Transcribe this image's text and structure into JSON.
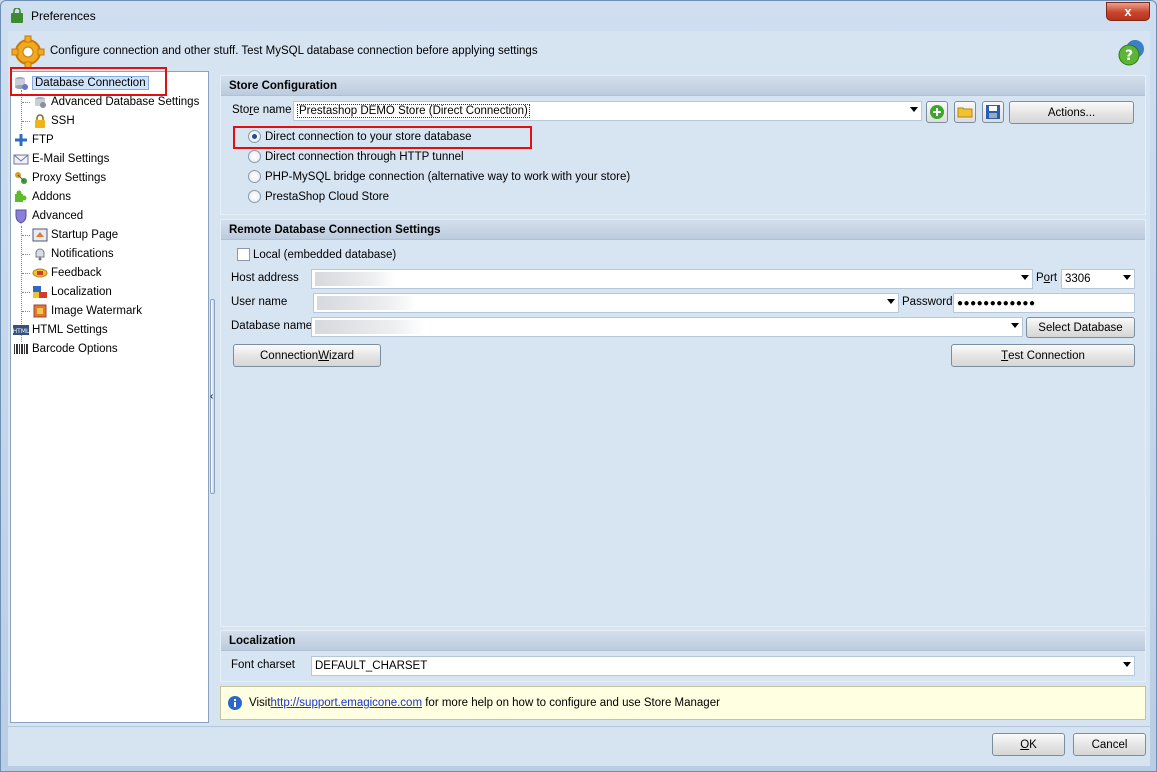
{
  "window": {
    "title": "Preferences",
    "close_symbol": "x",
    "header_text": "Configure connection and other stuff. Test MySQL database connection before applying settings"
  },
  "tree": {
    "items": [
      {
        "label": "Database Connection",
        "icon": "database-icon"
      },
      {
        "label": "Advanced Database Settings",
        "icon": "settings-icon"
      },
      {
        "label": "SSH",
        "icon": "lock-icon"
      },
      {
        "label": "FTP",
        "icon": "ftp-icon"
      },
      {
        "label": "E-Mail Settings",
        "icon": "mail-icon"
      },
      {
        "label": "Proxy Settings",
        "icon": "proxy-icon"
      },
      {
        "label": "Addons",
        "icon": "puzzle-icon"
      },
      {
        "label": "Advanced",
        "icon": "shield-icon"
      },
      {
        "label": "Startup Page",
        "icon": "page-icon"
      },
      {
        "label": "Notifications",
        "icon": "bell-icon"
      },
      {
        "label": "Feedback",
        "icon": "feedback-icon"
      },
      {
        "label": "Localization",
        "icon": "flags-icon"
      },
      {
        "label": "Image Watermark",
        "icon": "image-icon"
      },
      {
        "label": "HTML Settings",
        "icon": "html-icon"
      },
      {
        "label": "Barcode Options",
        "icon": "barcode-icon"
      }
    ]
  },
  "store_config": {
    "title": "Store Configuration",
    "store_name_label_pre": "Sto",
    "store_name_label_u": "r",
    "store_name_label_post": "e name",
    "store_name_value": "Prestashop DEMO Store (Direct Connection)",
    "actions_label": "Actions...",
    "connection_options": [
      {
        "label": "Direct connection to your store database",
        "checked": true
      },
      {
        "label": "Direct connection through HTTP tunnel",
        "checked": false
      },
      {
        "label": "PHP-MySQL bridge connection (alternative way to work with your store)",
        "checked": false
      },
      {
        "label": "PrestaShop Cloud Store",
        "checked": false
      }
    ]
  },
  "remote_db": {
    "title": "Remote Database Connection Settings",
    "local_label": "Local (embedded database)",
    "host_label": "Host address",
    "port_label_pre": "P",
    "port_label_u": "o",
    "port_label_post": "rt",
    "port_value": "3306",
    "user_label": "User name",
    "password_label": "Password",
    "password_value": "●●●●●●●●●●●●",
    "dbname_label": "Database name",
    "select_db_label": "Select Database",
    "wizard_pre": "Connection ",
    "wizard_u": "W",
    "wizard_post": "izard",
    "test_u": "T",
    "test_post": "est Connection"
  },
  "localization": {
    "title": "Localization",
    "charset_label": "Font charset",
    "charset_value": "DEFAULT_CHARSET"
  },
  "info": {
    "text_pre": "Visit ",
    "link": "http://support.emagicone.com",
    "text_post": " for more help on how to configure and use Store Manager"
  },
  "footer": {
    "ok_u": "O",
    "ok_post": "K",
    "cancel_label": "Cancel"
  },
  "colors": {
    "highlight_red": "#e01010",
    "accent_blue": "#1a35c5"
  }
}
